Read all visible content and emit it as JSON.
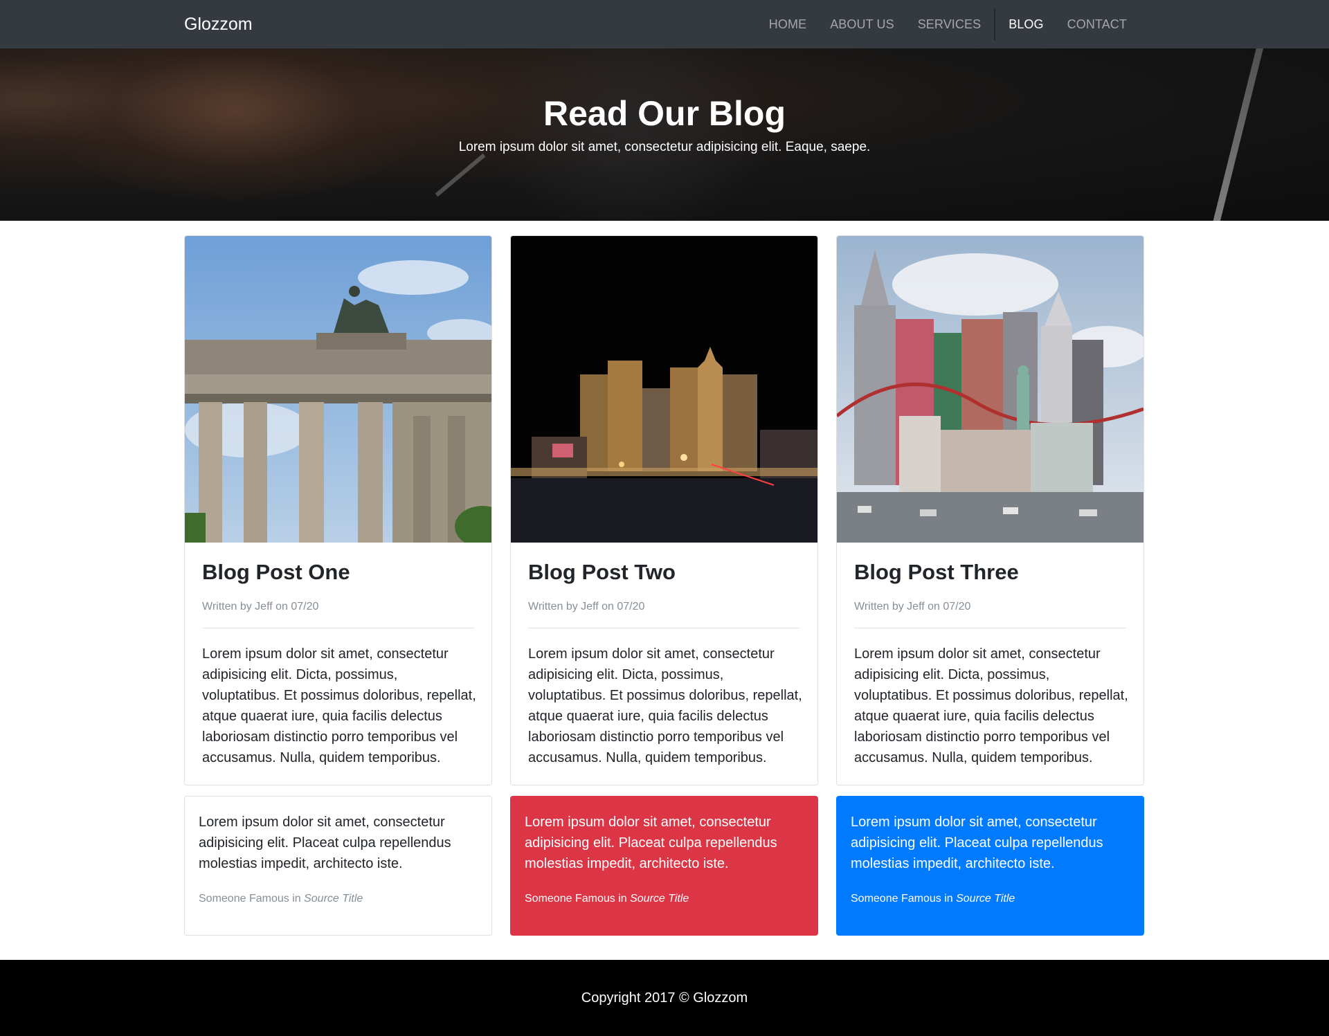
{
  "navbar": {
    "brand": "Glozzom",
    "items": [
      {
        "label": "HOME",
        "active": false
      },
      {
        "label": "ABOUT US",
        "active": false
      },
      {
        "label": "SERVICES",
        "active": false
      },
      {
        "label": "BLOG",
        "active": true
      },
      {
        "label": "CONTACT",
        "active": false
      }
    ]
  },
  "hero": {
    "title": "Read Our Blog",
    "subtitle": "Lorem ipsum dolor sit amet, consectetur adipisicing elit. Eaque, saepe."
  },
  "posts": [
    {
      "image": "brandenburg-gate-photo",
      "title": "Blog Post One",
      "meta": "Written by Jeff on 07/20",
      "body": "Lorem ipsum dolor sit amet, consectetur adipisicing elit. Dicta, possimus, voluptatibus. Et possimus doloribus, repellat, atque quaerat iure, quia facilis delectus laboriosam distinctio porro temporibus vel accusamus. Nulla, quidem temporibus."
    },
    {
      "image": "las-vegas-night-photo",
      "title": "Blog Post Two",
      "meta": "Written by Jeff on 07/20",
      "body": "Lorem ipsum dolor sit amet, consectetur adipisicing elit. Dicta, possimus, voluptatibus. Et possimus doloribus, repellat, atque quaerat iure, quia facilis delectus laboriosam distinctio porro temporibus vel accusamus. Nulla, quidem temporibus."
    },
    {
      "image": "new-york-new-york-casino-photo",
      "title": "Blog Post Three",
      "meta": "Written by Jeff on 07/20",
      "body": "Lorem ipsum dolor sit amet, consectetur adipisicing elit. Dicta, possimus, voluptatibus. Et possimus doloribus, repellat, atque quaerat iure, quia facilis delectus laboriosam distinctio porro temporibus vel accusamus. Nulla, quidem temporibus."
    }
  ],
  "quotes": [
    {
      "style": "white",
      "text": "Lorem ipsum dolor sit amet, consectetur adipisicing elit. Placeat culpa repellendus molestias impedit, architecto iste.",
      "author": "Someone Famous",
      "connector": "in",
      "source": "Source Title"
    },
    {
      "style": "red",
      "text": "Lorem ipsum dolor sit amet, consectetur adipisicing elit. Placeat culpa repellendus molestias impedit, architecto iste.",
      "author": "Someone Famous",
      "connector": "in",
      "source": "Source Title"
    },
    {
      "style": "blue",
      "text": "Lorem ipsum dolor sit amet, consectetur adipisicing elit. Placeat culpa repellendus molestias impedit, architecto iste.",
      "author": "Someone Famous",
      "connector": "in",
      "source": "Source Title"
    }
  ],
  "footer": {
    "text": "Copyright 2017 © Glozzom"
  },
  "colors": {
    "navbar": "#343a40",
    "danger": "#dc3545",
    "primary": "#007bff",
    "footer": "#000000"
  }
}
